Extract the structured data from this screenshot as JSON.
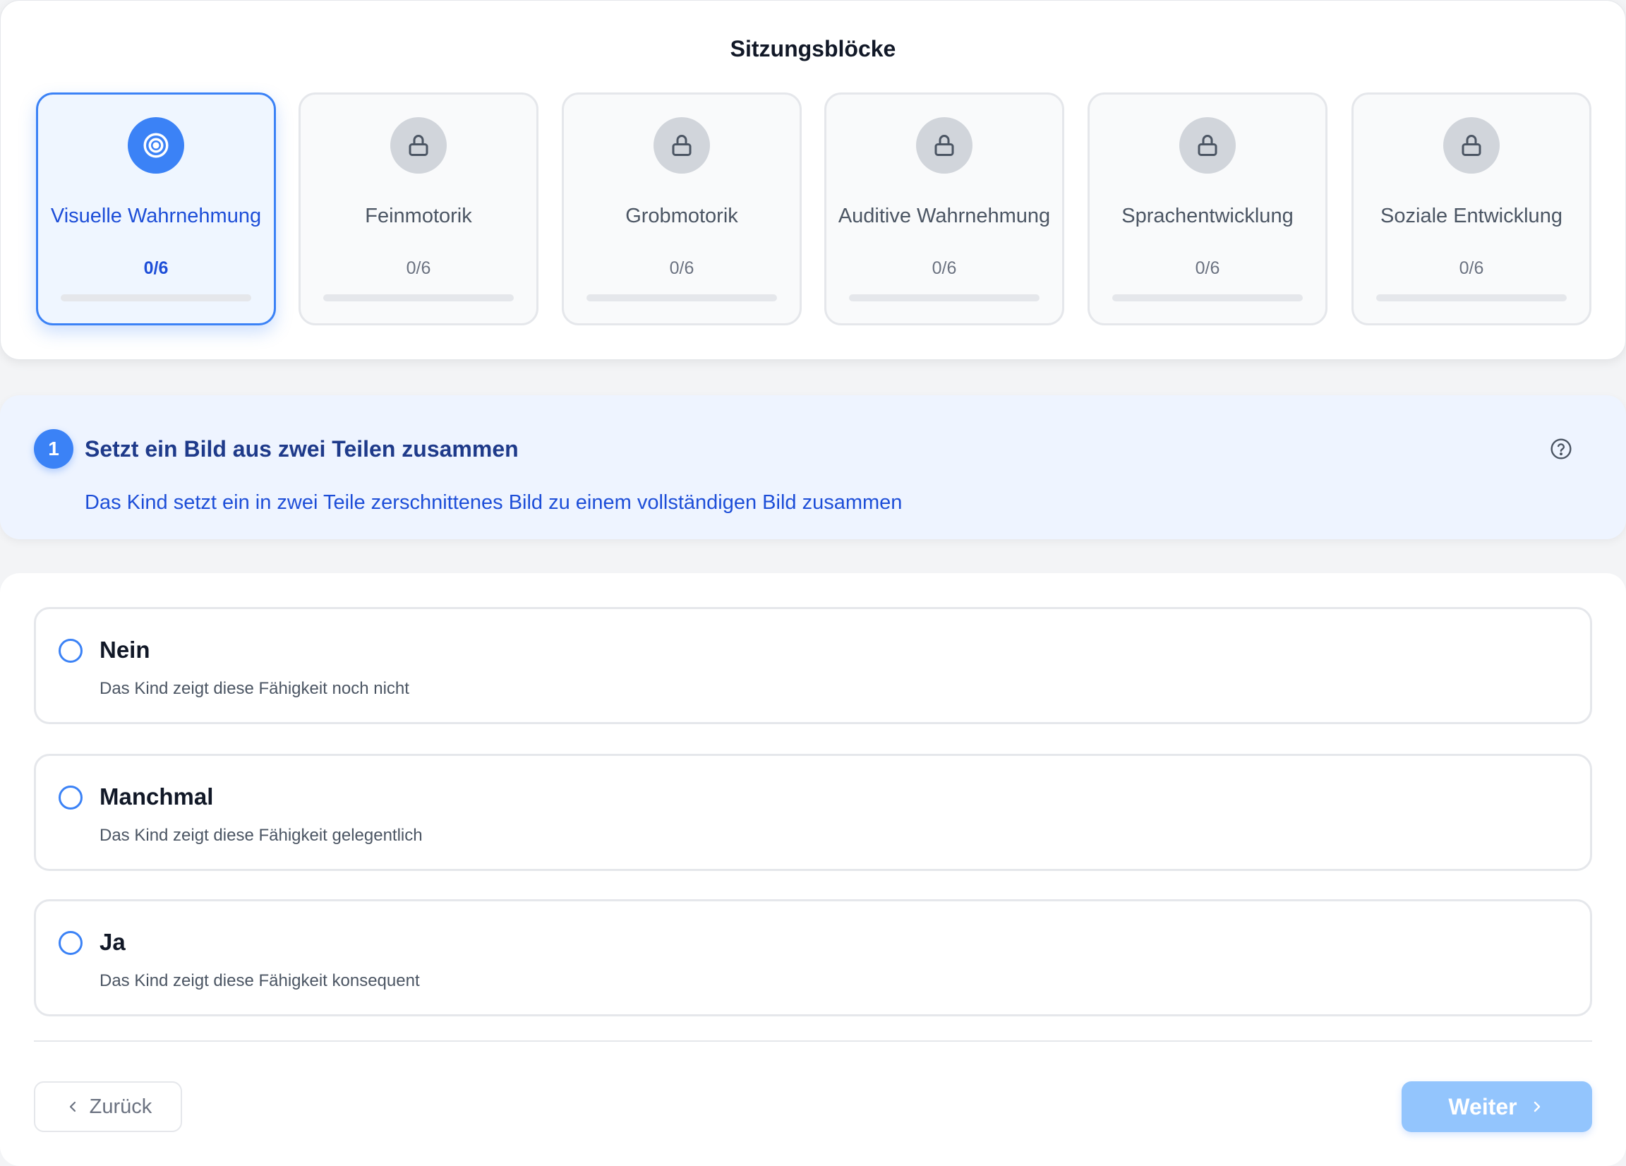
{
  "header": {
    "title": "Sitzungsblöcke"
  },
  "blocks": [
    {
      "label": "Visuelle Wahrnehmung",
      "count": "0/6",
      "progress": 0,
      "state": "active",
      "icon": "target-icon"
    },
    {
      "label": "Feinmotorik",
      "count": "0/6",
      "progress": 0,
      "state": "locked",
      "icon": "lock-icon"
    },
    {
      "label": "Grobmotorik",
      "count": "0/6",
      "progress": 0,
      "state": "locked",
      "icon": "lock-icon"
    },
    {
      "label": "Auditive Wahrnehmung",
      "count": "0/6",
      "progress": 0,
      "state": "locked",
      "icon": "lock-icon"
    },
    {
      "label": "Sprachentwicklung",
      "count": "0/6",
      "progress": 0,
      "state": "locked",
      "icon": "lock-icon"
    },
    {
      "label": "Soziale Entwicklung",
      "count": "0/6",
      "progress": 0,
      "state": "locked",
      "icon": "lock-icon"
    }
  ],
  "question": {
    "number": "1",
    "title": "Setzt ein Bild aus zwei Teilen zusammen",
    "description": "Das Kind setzt ein in zwei Teile zerschnittenes Bild zu einem vollständigen Bild zusammen",
    "help_icon": "help-circle-icon"
  },
  "options": [
    {
      "title": "Nein",
      "description": "Das Kind zeigt diese Fähigkeit noch nicht"
    },
    {
      "title": "Manchmal",
      "description": "Das Kind zeigt diese Fähigkeit gelegentlich"
    },
    {
      "title": "Ja",
      "description": "Das Kind zeigt diese Fähigkeit konsequent"
    }
  ],
  "nav": {
    "back_label": "Zurück",
    "next_label": "Weiter"
  },
  "colors": {
    "accent": "#3b82f6",
    "accent_dark": "#1d4ed8",
    "disabled_next": "#93c5fd",
    "locked": "#d1d5db"
  }
}
